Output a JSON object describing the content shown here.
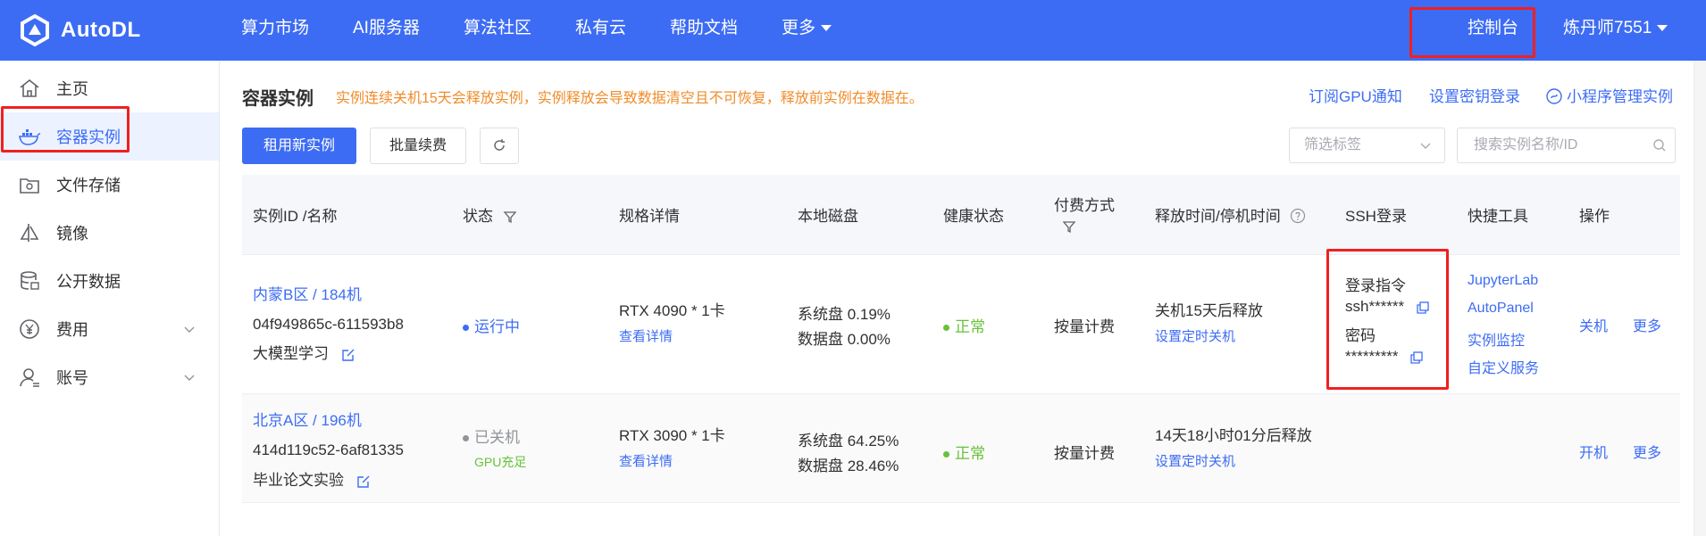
{
  "brand": {
    "name": "AutoDL"
  },
  "nav": {
    "items": [
      "算力市场",
      "AI服务器",
      "算法社区",
      "私有云",
      "帮助文档",
      "更多"
    ],
    "console": "控制台",
    "user": "炼丹师7551"
  },
  "sidebar": {
    "items": [
      {
        "label": "主页",
        "icon": "home-icon"
      },
      {
        "label": "容器实例",
        "icon": "docker-icon"
      },
      {
        "label": "文件存储",
        "icon": "storage-icon"
      },
      {
        "label": "镜像",
        "icon": "image-icon"
      },
      {
        "label": "公开数据",
        "icon": "database-icon"
      },
      {
        "label": "费用",
        "icon": "yen-icon"
      },
      {
        "label": "账号",
        "icon": "user-icon"
      }
    ]
  },
  "page": {
    "title": "容器实例",
    "warning": "实例连续关机15天会释放实例，实例释放会导致数据清空且不可恢复，释放前实例在数据在。",
    "links": {
      "gpu_notify": "订阅GPU通知",
      "ssh_key": "设置密钥登录",
      "miniprogram": "小程序管理实例"
    }
  },
  "toolbar": {
    "new_instance": "租用新实例",
    "batch_renew": "批量续费",
    "filter_placeholder": "筛选标签",
    "search_placeholder": "搜索实例名称/ID"
  },
  "table": {
    "headers": {
      "id": "实例ID /名称",
      "status": "状态",
      "spec": "规格详情",
      "disk": "本地磁盘",
      "health": "健康状态",
      "pay_line1": "付费方式",
      "release": "释放时间/停机时间",
      "ssh": "SSH登录",
      "tools": "快捷工具",
      "ops": "操作"
    },
    "rows": [
      {
        "region": "内蒙B区 / 184机",
        "id": "04f949865c-611593b8",
        "name": "大模型学习",
        "status": "运行中",
        "status_color": "#3d6cf4",
        "gpu_note": "",
        "spec": "RTX 4090 * 1卡",
        "spec_link": "查看详情",
        "disk_sys": "系统盘 0.19%",
        "disk_data": "数据盘 0.00%",
        "health": "正常",
        "pay": "按量计费",
        "release": "关机15天后释放",
        "timer": "设置定时关机",
        "ssh_cmd_label": "登录指令",
        "ssh_cmd": "ssh******",
        "ssh_pwd_label": "密码",
        "ssh_pwd": "*********",
        "tools": [
          "JupyterLab",
          "AutoPanel",
          "实例监控",
          "自定义服务"
        ],
        "op_main": "关机",
        "op_more": "更多"
      },
      {
        "region": "北京A区 / 196机",
        "id": "414d119c52-6af81335",
        "name": "毕业论文实验",
        "status": "已关机",
        "status_color": "#909399",
        "gpu_note": "GPU充足",
        "spec": "RTX 3090 * 1卡",
        "spec_link": "查看详情",
        "disk_sys": "系统盘 64.25%",
        "disk_data": "数据盘 28.46%",
        "health": "正常",
        "pay": "按量计费",
        "release": "14天18小时01分后释放",
        "timer": "设置定时关机",
        "op_main": "开机",
        "op_more": "更多"
      }
    ]
  },
  "colors": {
    "brand": "#3d6cf4",
    "warning": "#f08c2a",
    "success": "#67c23a",
    "highlight": "#f02020"
  }
}
